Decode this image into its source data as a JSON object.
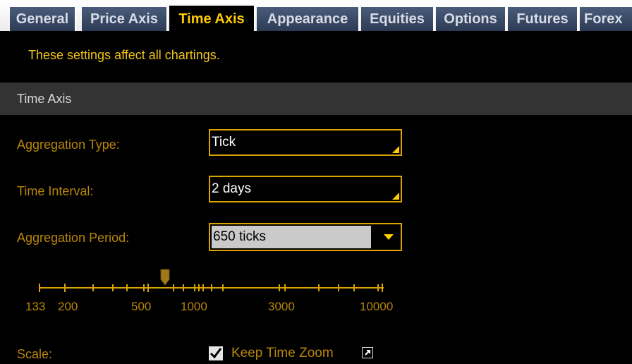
{
  "tabs": [
    {
      "label": "General"
    },
    {
      "label": "Price Axis"
    },
    {
      "label": "Time Axis"
    },
    {
      "label": "Appearance"
    },
    {
      "label": "Equities"
    },
    {
      "label": "Options"
    },
    {
      "label": "Futures"
    },
    {
      "label": "Forex"
    }
  ],
  "active_tab": "Time Axis",
  "notice": "These settings affect all chartings.",
  "section": {
    "title": "Time Axis"
  },
  "fields": {
    "aggregation_type": {
      "label": "Aggregation Type:",
      "value": "Tick"
    },
    "time_interval": {
      "label": "Time Interval:",
      "value": "2 days"
    },
    "aggregation_period": {
      "label": "Aggregation Period:",
      "value": "650 ticks"
    }
  },
  "slider": {
    "tick_labels": [
      "133",
      "200",
      "500",
      "1000",
      "3000",
      "10000"
    ],
    "value": 650
  },
  "scale": {
    "label": "Scale:",
    "checkbox_label": "Keep Time Zoom",
    "checked": true
  },
  "colors": {
    "accent": "#ffcc00",
    "label": "#b8860b",
    "tab": "#34435f",
    "section": "#333333"
  }
}
